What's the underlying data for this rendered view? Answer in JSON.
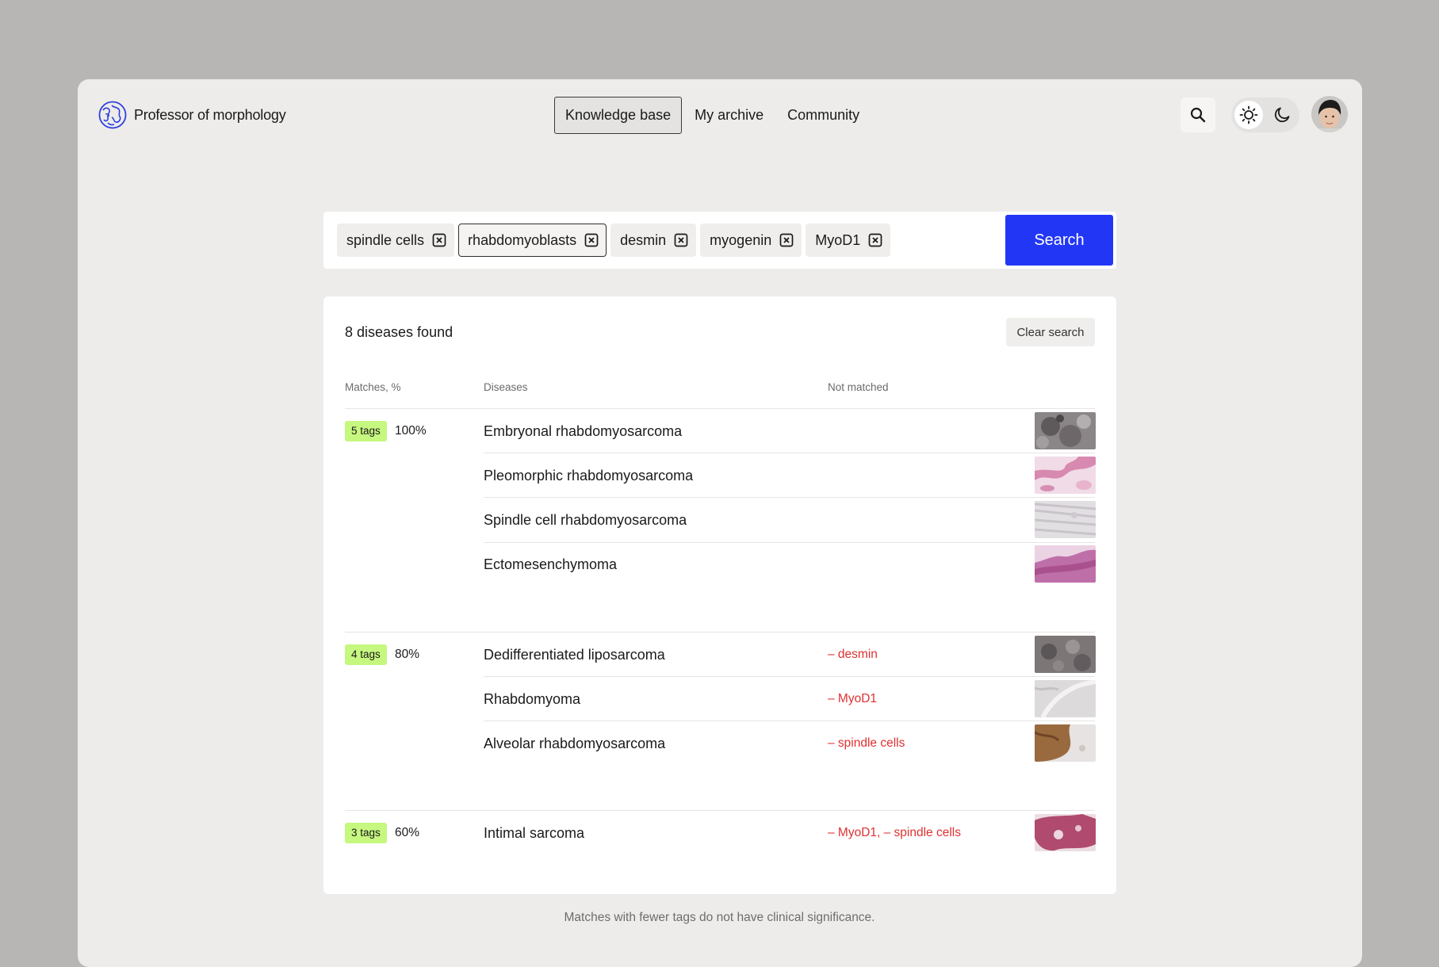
{
  "app": {
    "title": "Professor of morphology"
  },
  "nav": {
    "items": [
      {
        "label": "Knowledge base",
        "active": true
      },
      {
        "label": "My archive",
        "active": false
      },
      {
        "label": "Community",
        "active": false
      }
    ]
  },
  "icons": {
    "logo": "globe-logo-icon",
    "search": "search-icon",
    "sun": "sun-icon",
    "moon": "moon-icon",
    "tag_remove": "close-box-icon"
  },
  "colors": {
    "accent": "#2237f5",
    "badge": "#c6f77f",
    "not_matched": "#e03131"
  },
  "search": {
    "tags": [
      "spindle cells",
      "rhabdomyoblasts",
      "desmin",
      "myogenin",
      "MyoD1"
    ],
    "active_tag": "rhabdomyoblasts",
    "button_label": "Search"
  },
  "results": {
    "found_label": "8 diseases found",
    "clear_label": "Clear search",
    "columns": {
      "matches": "Matches, %",
      "diseases": "Diseases",
      "not_matched": "Not matched"
    },
    "groups": [
      {
        "badge": "5 tags",
        "percent": "100%",
        "rows": [
          {
            "disease": "Embryonal rhabdomyosarcoma",
            "not_matched": ""
          },
          {
            "disease": "Pleomorphic rhabdomyosarcoma",
            "not_matched": ""
          },
          {
            "disease": "Spindle cell rhabdomyosarcoma",
            "not_matched": ""
          },
          {
            "disease": "Ectomesenchymoma",
            "not_matched": ""
          }
        ]
      },
      {
        "badge": "4 tags",
        "percent": "80%",
        "rows": [
          {
            "disease": "Dedifferentiated liposarcoma",
            "not_matched": "– desmin"
          },
          {
            "disease": "Rhabdomyoma",
            "not_matched": "– MyoD1"
          },
          {
            "disease": "Alveolar rhabdomyosarcoma",
            "not_matched": "– spindle cells"
          }
        ]
      },
      {
        "badge": "3 tags",
        "percent": "60%",
        "rows": [
          {
            "disease": "Intimal sarcoma",
            "not_matched": "– MyoD1, – spindle cells"
          }
        ]
      }
    ]
  },
  "footer": {
    "note": "Matches with fewer tags do not have clinical significance."
  }
}
